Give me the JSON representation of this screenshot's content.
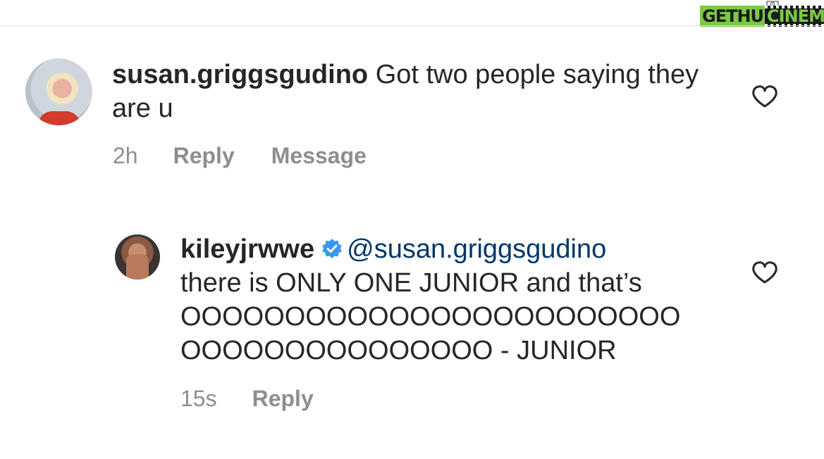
{
  "watermark": {
    "left_text": "GETHU",
    "right_text": "CINEMA"
  },
  "comments": [
    {
      "username": "susan.griggsgudino",
      "text": "Got two people saying they are u",
      "time": "2h",
      "actions": [
        "Reply",
        "Message"
      ]
    },
    {
      "username": "kileyjrwwe",
      "verified": true,
      "mention": "@susan.griggsgudino",
      "lines": [
        "there is ONLY ONE JUNIOR and that’s",
        "OOOOOOOOOOOOOOOOOOOOOOOO",
        "OOOOOOOOOOOOOOO - JUNIOR"
      ],
      "time": "15s",
      "actions": [
        "Reply"
      ]
    }
  ],
  "colors": {
    "text": "#262626",
    "meta": "#8e8e8e",
    "mention": "#00376b",
    "verified": "#3897f0"
  },
  "icons": [
    "heart-icon",
    "verified-badge-icon",
    "camera-icon"
  ]
}
